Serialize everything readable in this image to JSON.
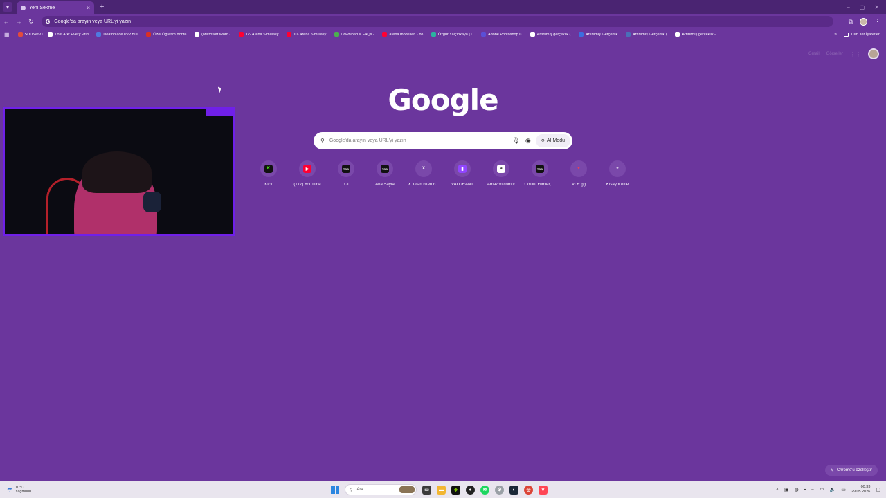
{
  "browser": {
    "tab": {
      "title": "Yeni Sekme",
      "close": "×"
    },
    "new_tab": "+",
    "window_controls": [
      "–",
      "▢",
      "✕"
    ],
    "omnibox": {
      "placeholder": "Google'da arayın veya URL'yi yazın"
    }
  },
  "bookmarks": {
    "items": [
      {
        "label": "SDUNetV1",
        "color": "#e34b3c"
      },
      {
        "label": "Lost Ark: Every Prid...",
        "color": "#ffffff"
      },
      {
        "label": "Deathblade PvP Buil...",
        "color": "#4f7be0"
      },
      {
        "label": "Özel Öğretim Yönte...",
        "color": "#d93025"
      },
      {
        "label": "(Microsoft Word -...",
        "color": "#ffffff"
      },
      {
        "label": "12- Arena Simülasy...",
        "color": "#ff0033"
      },
      {
        "label": "10- Arena Simülasy...",
        "color": "#ff0033"
      },
      {
        "label": "Download & FAQs -...",
        "color": "#4caf50"
      },
      {
        "label": "arena modelleri - Yo...",
        "color": "#ff0033"
      },
      {
        "label": "Özgür Yalçınkaya | L...",
        "color": "#2bb3a0"
      },
      {
        "label": "Adobe Photoshop C...",
        "color": "#5b4fd6"
      },
      {
        "label": "Artırılmış gerçeklik (...",
        "color": "#ffffff"
      },
      {
        "label": "Artırılmış Gerçeklik...",
        "color": "#3c6ee0"
      },
      {
        "label": "Artırılmış Gerçeklik (...",
        "color": "#4a6fb8"
      },
      {
        "label": "Artırılmış gerçeklik -...",
        "color": "#ffffff"
      }
    ],
    "more": "»",
    "all_bookmarks": "Tüm Yer İşaretleri"
  },
  "google_links": {
    "gmail": "Gmail",
    "images": "Görseller"
  },
  "logo": "Google",
  "search": {
    "placeholder": "Google'da arayın veya URL'yi yazın",
    "ai_mode": "AI Modu"
  },
  "shortcuts": [
    {
      "label": "Kick",
      "glyph": "K",
      "bg": "#111111",
      "fg": "#53fc18"
    },
    {
      "label": "(177) YouTube",
      "glyph": "▶",
      "bg": "#ff0033",
      "fg": "#ffffff"
    },
    {
      "label": "TOD",
      "glyph": "TOD",
      "bg": "#111111",
      "fg": "#ffffff"
    },
    {
      "label": "Ana Sayfa",
      "glyph": "TOD",
      "bg": "#111111",
      "fg": "#ffffff"
    },
    {
      "label": "X. Olan biten b...",
      "glyph": "X",
      "bg": "#7a48aa",
      "fg": "#ffffff"
    },
    {
      "label": "VALORANT",
      "glyph": "▮",
      "bg": "#9146ff",
      "fg": "#ffffff"
    },
    {
      "label": "Amazon.com.tr",
      "glyph": "a",
      "bg": "#ffffff",
      "fg": "#111111"
    },
    {
      "label": "Ödüllü Filmler, ...",
      "glyph": "TOD",
      "bg": "#111111",
      "fg": "#ffffff"
    },
    {
      "label": "VLR.gg",
      "glyph": "▼",
      "bg": "#7a48aa",
      "fg": "#e84057"
    },
    {
      "label": "Kısayol ekle",
      "glyph": "+",
      "bg": "#7a48aa",
      "fg": "#ffffff"
    }
  ],
  "customize": "Chrome'u özelleştir",
  "taskbar": {
    "weather_temp": "10°C",
    "weather_desc": "Yağmurlu",
    "search_placeholder": "Ara",
    "time": "00:33",
    "date": "29.05.2026"
  }
}
